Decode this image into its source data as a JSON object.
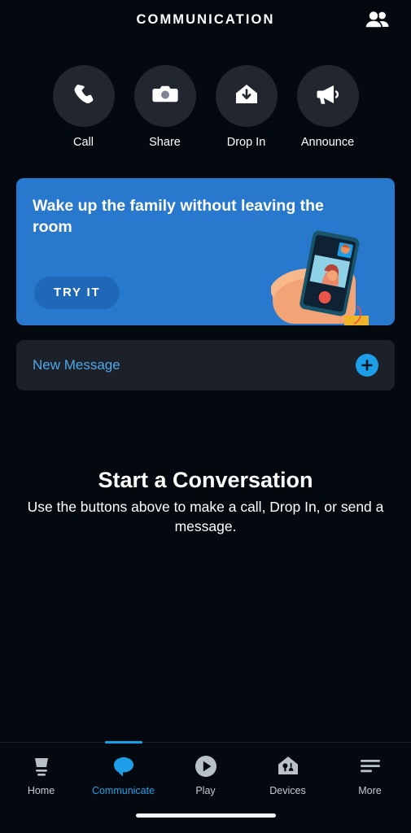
{
  "header": {
    "title": "COMMUNICATION",
    "contacts_icon": "contacts-people-icon"
  },
  "actions": [
    {
      "label": "Call",
      "icon": "phone-icon"
    },
    {
      "label": "Share",
      "icon": "camera-icon"
    },
    {
      "label": "Drop In",
      "icon": "house-arrow-down-icon"
    },
    {
      "label": "Announce",
      "icon": "megaphone-icon"
    }
  ],
  "promo": {
    "title": "Wake up the family without leaving the room",
    "button_label": "TRY IT",
    "art": "hand-holding-phone-video-call-illustration",
    "bg_color": "#2878CE",
    "button_color": "#1F68B8"
  },
  "new_message": {
    "label": "New Message",
    "plus_icon": "plus-icon",
    "accent_color": "#4FA8E8"
  },
  "empty_state": {
    "title": "Start a Conversation",
    "subtitle": "Use the buttons above to make a call, Drop In, or send a message."
  },
  "bottom_nav": {
    "active_color": "#1C9FE8",
    "items": [
      {
        "label": "Home",
        "icon": "echo-device-icon",
        "active": false
      },
      {
        "label": "Communicate",
        "icon": "speech-bubble-icon",
        "active": true
      },
      {
        "label": "Play",
        "icon": "play-circle-icon",
        "active": false
      },
      {
        "label": "Devices",
        "icon": "house-devices-icon",
        "active": false
      },
      {
        "label": "More",
        "icon": "hamburger-menu-icon",
        "active": false
      }
    ]
  }
}
